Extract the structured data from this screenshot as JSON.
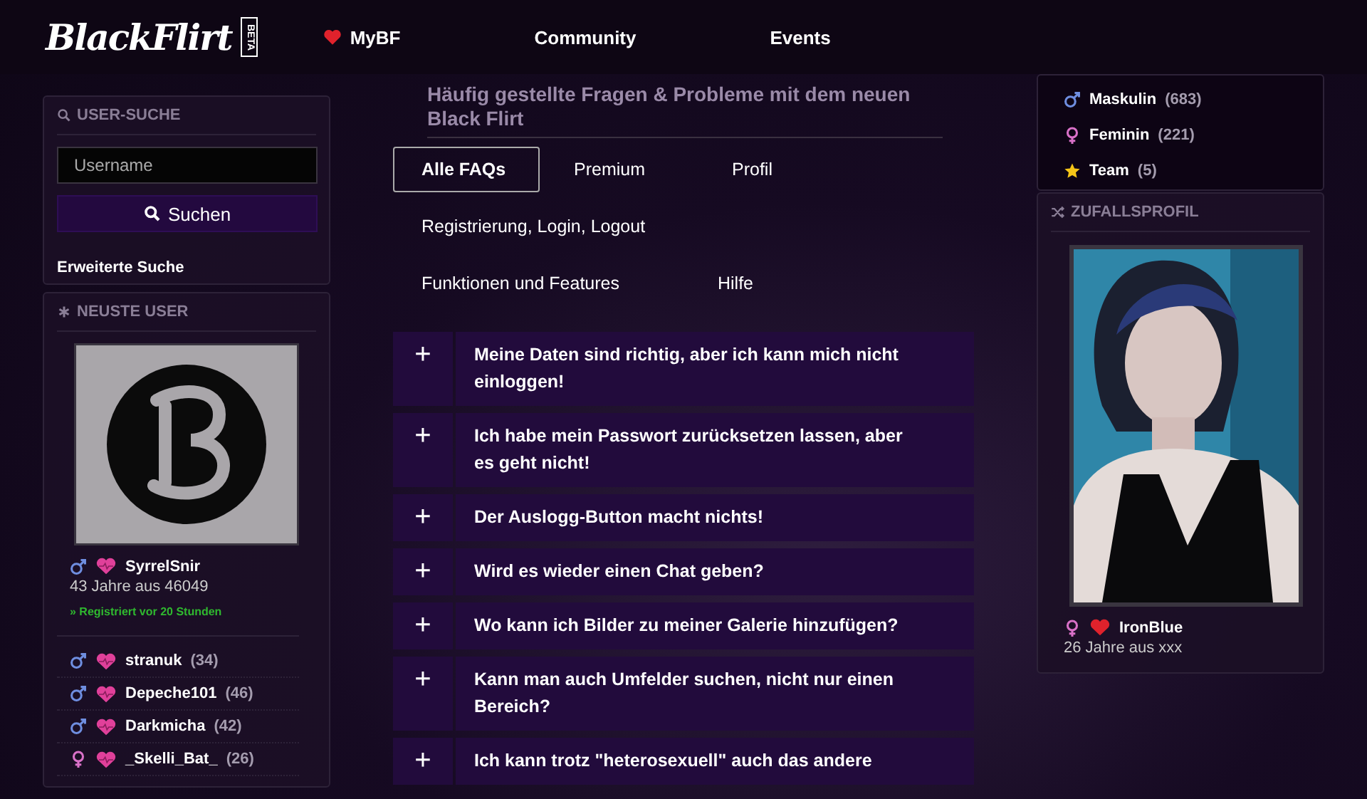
{
  "header": {
    "logo": "BlackFlirt",
    "badge": "BETA",
    "nav": [
      {
        "label": "MyBF",
        "kind": "heart"
      },
      {
        "label": "Community",
        "kind": "plain"
      },
      {
        "label": "Events",
        "kind": "plain"
      }
    ]
  },
  "page_title": "Häufig gestellte Fragen & Probleme mit dem neuen Black Flirt",
  "user_search": {
    "title": "USER-SUCHE",
    "placeholder": "Username",
    "button": "Suchen",
    "link": "Erweiterte Suche"
  },
  "newest_users": {
    "title": "NEUSTE USER",
    "featured": {
      "kind": "male",
      "name": "SyrrelSnir",
      "info": "43 Jahre aus 46049",
      "registered": "» Registriert vor 20 Stunden"
    },
    "users": [
      {
        "kind": "male",
        "name": "stranuk",
        "age": "(34)"
      },
      {
        "kind": "male",
        "name": "Depeche101",
        "age": "(46)"
      },
      {
        "kind": "male",
        "name": "Darkmicha",
        "age": "(42)"
      },
      {
        "kind": "female",
        "name": "_Skelli_Bat_",
        "age": "(26)"
      }
    ]
  },
  "tabs": [
    {
      "label": "Alle FAQs",
      "selected": true
    },
    {
      "label": "Premium",
      "selected": false
    },
    {
      "label": "Profil",
      "selected": false
    },
    {
      "label": "Registrierung, Login, Logout",
      "selected": false
    },
    {
      "label": "Funktionen und Features",
      "selected": false
    },
    {
      "label": "Hilfe",
      "selected": false
    }
  ],
  "faqs": [
    {
      "sign": "+",
      "question": "Meine Daten sind richtig, aber ich kann mich nicht einloggen!"
    },
    {
      "sign": "+",
      "question": "Ich habe mein Passwort zurücksetzen lassen, aber es geht nicht!"
    },
    {
      "sign": "+",
      "question": "Der Auslogg-Button macht nichts!"
    },
    {
      "sign": "+",
      "question": "Wird es wieder einen Chat geben?"
    },
    {
      "sign": "+",
      "question": "Wo kann ich Bilder zu meiner Galerie hinzufügen?"
    },
    {
      "sign": "+",
      "question": "Kann man auch Umfelder suchen, nicht nur einen Bereich?"
    },
    {
      "sign": "+",
      "question": "Ich kann trotz \"heterosexuell\" auch das andere"
    }
  ],
  "gender_stats": [
    {
      "kind": "male",
      "label": "Maskulin",
      "count": "(683)"
    },
    {
      "kind": "female",
      "label": "Feminin",
      "count": "(221)"
    },
    {
      "kind": "team",
      "label": "Team",
      "count": "(5)"
    }
  ],
  "random_profile": {
    "title": "ZUFALLSPROFIL",
    "kind": "female",
    "name": "IronBlue",
    "info": "26 Jahre aus xxx"
  }
}
